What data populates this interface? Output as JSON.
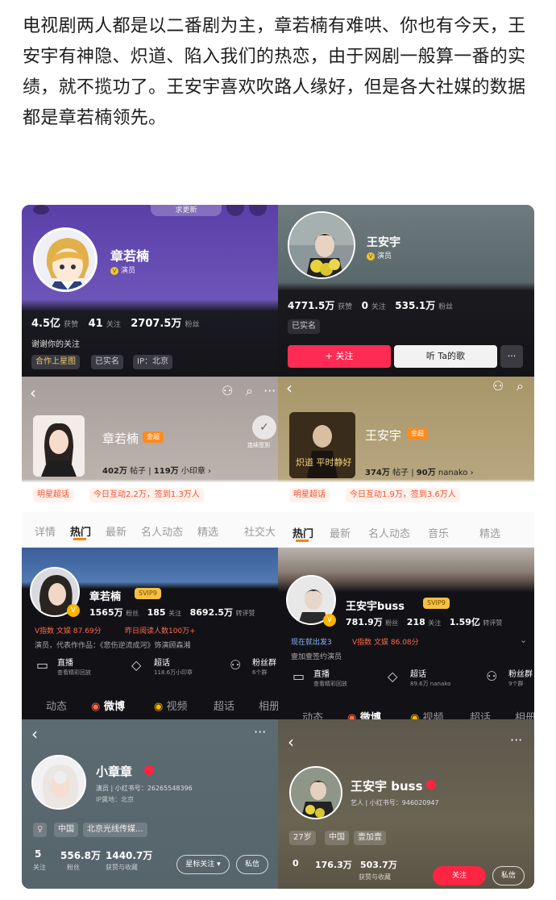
{
  "intro": "电视剧两人都是以二番剧为主，章若楠有难哄、你也有今天，王安宇有神隐、炽道、陷入我们的热恋，由于网剧一般算一番的实绩，就不揽功了。王安宇喜欢吹路人缘好，但是各大社媒的数据都是章若楠领先。",
  "dy_left": {
    "top_hint": "求更新",
    "name": "章若楠",
    "role": "演员",
    "likes": "4.5亿",
    "likes_label": "获赞",
    "follow": "41",
    "follow_label": "关注",
    "fans": "2707.5万",
    "fans_label": "粉丝",
    "bio": "谢谢你的关注",
    "tags": [
      "合作上星图",
      "已实名",
      "IP：北京"
    ]
  },
  "dy_right": {
    "name": "王安宇",
    "role": "演员",
    "likes": "4771.5万",
    "likes_label": "获赞",
    "follow": "0",
    "follow_label": "关注",
    "fans": "535.1万",
    "fans_label": "粉丝",
    "tag": "已实名",
    "follow_btn": "+ 关注",
    "music_btn": "听 Ta的歌",
    "more": "···"
  },
  "chao_left": {
    "name": "章若楠",
    "badge": "金超",
    "posts": "402万",
    "posts_label": "帖子",
    "stamp": "119万",
    "stamp_label": "小印章 ›",
    "checkin_hint": "连续签到",
    "chip1": "明星超话",
    "chip2": "今日互动2.2万，签到1.3万人",
    "tabs": [
      "详情",
      "热门",
      "最新",
      "名人动态",
      "精选",
      "社交大"
    ]
  },
  "chao_right": {
    "name": "王安宇",
    "badge": "金超",
    "poster_text": "炽道 平时静好",
    "posts": "374万",
    "posts_label": "帖子",
    "stamp": "90万",
    "stamp_label": "nanako ›",
    "chip1": "明星超话",
    "chip2": "今日互动1.9万，签到3.6万人",
    "tabs": [
      "热门",
      "最新",
      "名人动态",
      "音乐",
      "精选"
    ]
  },
  "wb_left": {
    "name": "章若楠",
    "vip": "SVIP9",
    "fans": "1565万",
    "fans_label": "粉丝",
    "follow": "185",
    "follow_label": "关注",
    "reposts": "8692.5万",
    "reposts_label": "转评赞",
    "v_index": "V指数 文娱 87.69分",
    "read": "昨日阅读人数100万+",
    "work": "演员，代表作作品：《悲伤逆流成河》饰演顾森湘",
    "f1": "直播",
    "f1s": "查看精彩回放",
    "f2": "超话",
    "f2s": "118.6万小印章",
    "f3": "粉丝群",
    "f3s": "6个群",
    "tabs": [
      "动态",
      "微博",
      "视频",
      "超话",
      "相册"
    ]
  },
  "wb_right": {
    "name": "王安宇buss",
    "vip": "SVIP9",
    "fans": "781.9万",
    "fans_label": "粉丝",
    "follow": "218",
    "follow_label": "关注",
    "reposts": "1.59亿",
    "reposts_label": "转评赞",
    "now": "现在就出发3",
    "v_index": "V指数 文娱 86.08分",
    "work": "壹加壹签约演员",
    "f1": "直播",
    "f1s": "查看精彩回放",
    "f2": "超话",
    "f2s": "89.6万 nanako",
    "f3": "粉丝群",
    "f3s": "9个群",
    "tabs": [
      "动态",
      "微博",
      "视频",
      "超话",
      "相册"
    ]
  },
  "xhs_left": {
    "name": "小章章",
    "meta": "演员 | 小红书号：26265548396",
    "ip": "IP属地：北京",
    "tags": [
      "中国",
      "北京光线传媒..."
    ],
    "follow": "5",
    "follow_label": "关注",
    "fans": "556.8万",
    "fans_label": "粉丝",
    "likes": "1440.7万",
    "likes_label": "获赞与收藏",
    "star_btn": "星标关注 ▾",
    "dm_btn": "私信"
  },
  "xhs_right": {
    "name": "王安宇 buss",
    "meta": "艺人 | 小红书号：946020947",
    "tags": [
      "27岁",
      "中国",
      "壹加壹"
    ],
    "follow": "0",
    "fans": "176.3万",
    "likes": "503.7万",
    "likes_label": "获赞与收藏",
    "follow_btn": "关注",
    "dm_btn": "私信"
  }
}
